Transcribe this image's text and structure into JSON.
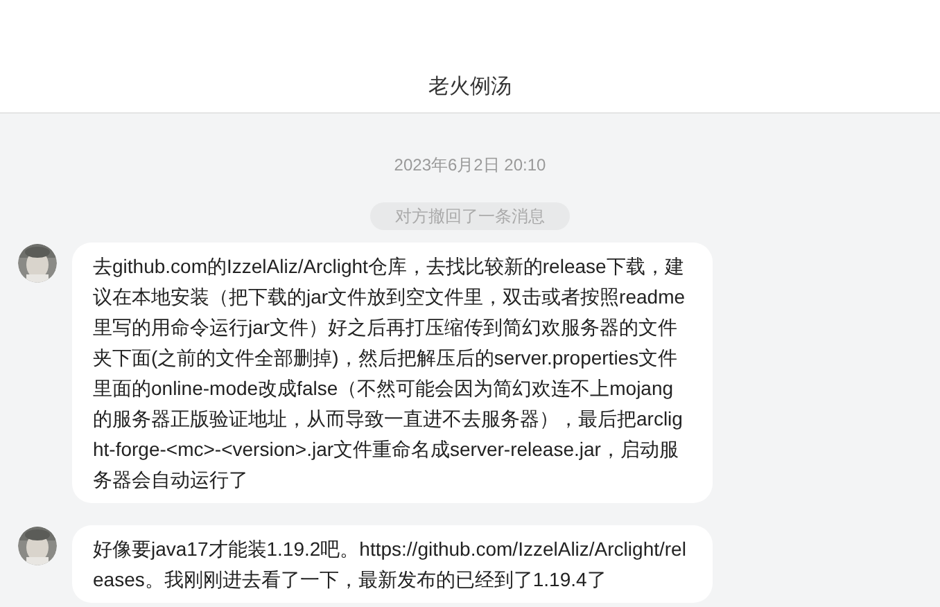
{
  "header": {
    "title": "老火例汤"
  },
  "timestamp": "2023年6月2日 20:10",
  "notice": "对方撤回了一条消息",
  "messages": [
    {
      "text": "去github.com的IzzelAliz/Arclight仓库，去找比较新的release下载，建议在本地安装（把下载的jar文件放到空文件里，双击或者按照readme里写的用命令运行jar文件）好之后再打压缩传到简幻欢服务器的文件夹下面(之前的文件全部删掉)，然后把解压后的server.properties文件里面的online-mode改成false（不然可能会因为简幻欢连不上mojang的服务器正版验证地址，从而导致一直进不去服务器），最后把arclight-forge-<mc>-<version>.jar文件重命名成server-release.jar，启动服务器会自动运行了"
    },
    {
      "text": "好像要java17才能装1.19.2吧。https://github.com/IzzelAliz/Arclight/releases。我刚刚进去看了一下，最新发布的已经到了1.19.4了"
    }
  ]
}
